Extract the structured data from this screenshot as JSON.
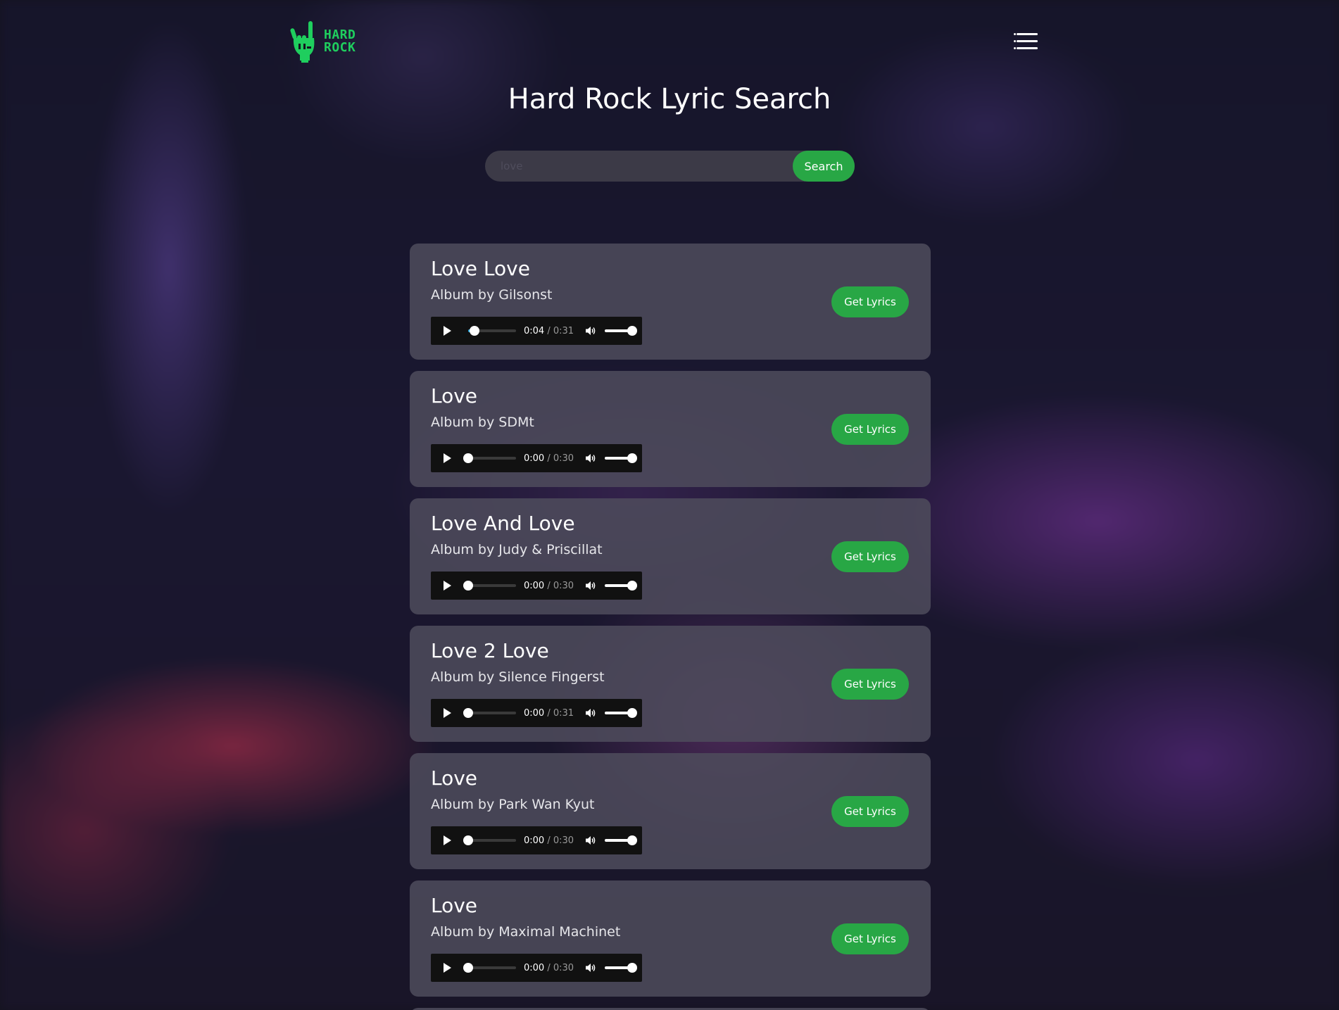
{
  "brand": {
    "logo_line1": "HARD",
    "logo_line2": "ROCK",
    "accent_color": "#1fce5e"
  },
  "header": {
    "menu_icon": "hamburger-menu-icon"
  },
  "page_title": "Hard Rock Lyric Search",
  "search": {
    "value": "",
    "placeholder": "love",
    "button_label": "Search"
  },
  "results": [
    {
      "title": "Love Love",
      "artist": "Album by Gilsonst",
      "current_time": "0:04",
      "duration": "0:31",
      "progress": 0.13,
      "volume": 1.0,
      "button_label": "Get Lyrics"
    },
    {
      "title": "Love",
      "artist": "Album by SDMt",
      "current_time": "0:00",
      "duration": "0:30",
      "progress": 0.0,
      "volume": 1.0,
      "button_label": "Get Lyrics"
    },
    {
      "title": "Love And Love",
      "artist": "Album by Judy & Priscillat",
      "current_time": "0:00",
      "duration": "0:30",
      "progress": 0.0,
      "volume": 1.0,
      "button_label": "Get Lyrics"
    },
    {
      "title": "Love 2 Love",
      "artist": "Album by Silence Fingerst",
      "current_time": "0:00",
      "duration": "0:31",
      "progress": 0.0,
      "volume": 1.0,
      "button_label": "Get Lyrics"
    },
    {
      "title": "Love",
      "artist": "Album by Park Wan Kyut",
      "current_time": "0:00",
      "duration": "0:30",
      "progress": 0.0,
      "volume": 1.0,
      "button_label": "Get Lyrics"
    },
    {
      "title": "Love",
      "artist": "Album by Maximal Machinet",
      "current_time": "0:00",
      "duration": "0:30",
      "progress": 0.0,
      "volume": 1.0,
      "button_label": "Get Lyrics"
    }
  ],
  "time_separator": "/",
  "colors": {
    "button_green": "#28a745",
    "progress_blue": "#29a8e0",
    "card_background": "#4e4c5c"
  }
}
